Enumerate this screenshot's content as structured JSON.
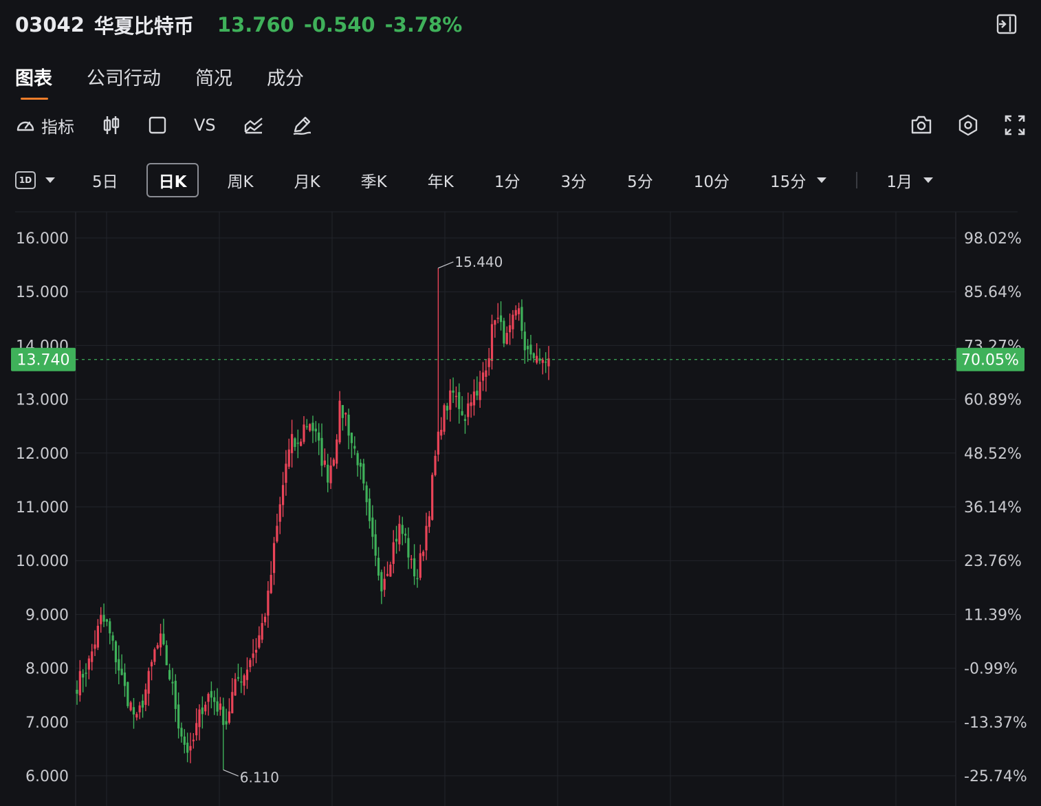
{
  "header": {
    "code": "03042",
    "name": "华夏比特币",
    "price": "13.760",
    "change": "-0.540",
    "change_pct": "-3.78%"
  },
  "tabs": [
    {
      "label": "图表",
      "active": true
    },
    {
      "label": "公司行动",
      "active": false
    },
    {
      "label": "简况",
      "active": false
    },
    {
      "label": "成分",
      "active": false
    }
  ],
  "toolbar": {
    "indicator_label": "指标",
    "vs_label": "VS",
    "icons": [
      "gauge-icon",
      "candlestick-icon",
      "square-icon",
      "compare-icon",
      "chart-type-icon",
      "draw-icon",
      "camera-icon",
      "settings-icon",
      "fullscreen-icon",
      "exit-icon"
    ]
  },
  "periods": {
    "badge": "1D",
    "items": [
      "5日",
      "日K",
      "周K",
      "月K",
      "季K",
      "年K",
      "1分",
      "3分",
      "5分",
      "10分",
      "15分"
    ],
    "active": "日K",
    "range_label": "1月"
  },
  "colors": {
    "up": "#ea4458",
    "down": "#3fb15a",
    "background": "#121317",
    "accent": "#ef7d2a"
  },
  "chart_data": {
    "type": "candlestick",
    "y_left_ticks": [
      "16.000",
      "15.000",
      "14.000",
      "13.000",
      "12.000",
      "11.000",
      "10.000",
      "9.000",
      "8.000",
      "7.000",
      "6.000"
    ],
    "y_right_ticks": [
      "98.02%",
      "85.64%",
      "73.27%",
      "60.89%",
      "48.52%",
      "36.14%",
      "23.76%",
      "11.39%",
      "-0.99%",
      "-13.37%",
      "-25.74%"
    ],
    "ylim": [
      5.5,
      16.5
    ],
    "current_price": "13.740",
    "current_pct": "70.05%",
    "max_label": "15.440",
    "min_label": "6.110",
    "max_value": 15.44,
    "min_value": 6.11,
    "grid": true,
    "closes": [
      7.7,
      7.9,
      8.1,
      8.5,
      8.9,
      8.8,
      8.4,
      8.0,
      7.6,
      7.3,
      7.0,
      7.4,
      7.8,
      8.3,
      8.5,
      8.1,
      7.6,
      7.0,
      6.6,
      6.4,
      6.9,
      7.3,
      7.5,
      7.4,
      7.2,
      7.0,
      7.5,
      7.8,
      7.9,
      8.2,
      8.4,
      8.8,
      9.3,
      10.2,
      11.0,
      11.8,
      12.2,
      12.1,
      12.5,
      12.6,
      12.3,
      11.9,
      11.6,
      12.0,
      12.8,
      12.7,
      12.2,
      11.9,
      11.3,
      10.6,
      10.0,
      9.6,
      9.9,
      10.3,
      10.6,
      10.4,
      9.9,
      9.7,
      10.3,
      11.0,
      11.9,
      12.6,
      12.9,
      13.1,
      12.9,
      12.7,
      13.1,
      13.0,
      13.5,
      13.9,
      14.6,
      14.3,
      14.1,
      14.4,
      14.6,
      14.0,
      13.7,
      13.9,
      13.6,
      13.76
    ]
  }
}
